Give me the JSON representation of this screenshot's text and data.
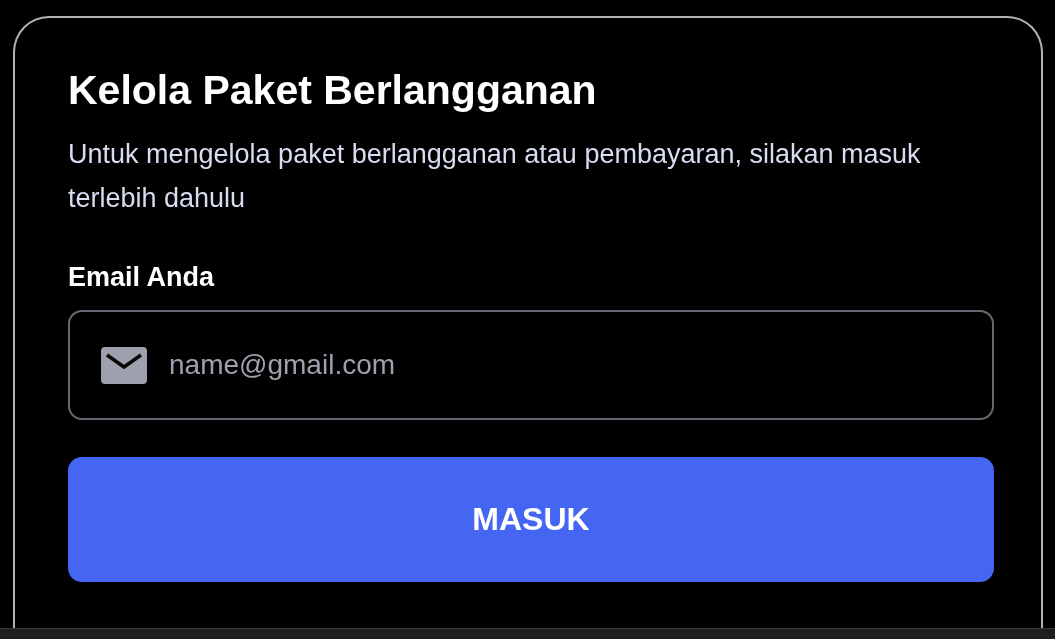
{
  "card": {
    "title": "Kelola Paket Berlangganan",
    "description": "Untuk mengelola paket berlangganan atau pembayaran, silakan masuk terlebih dahulu",
    "email_field": {
      "label": "Email Anda",
      "placeholder": "name@gmail.com"
    },
    "submit_button": {
      "label": "MASUK"
    }
  }
}
